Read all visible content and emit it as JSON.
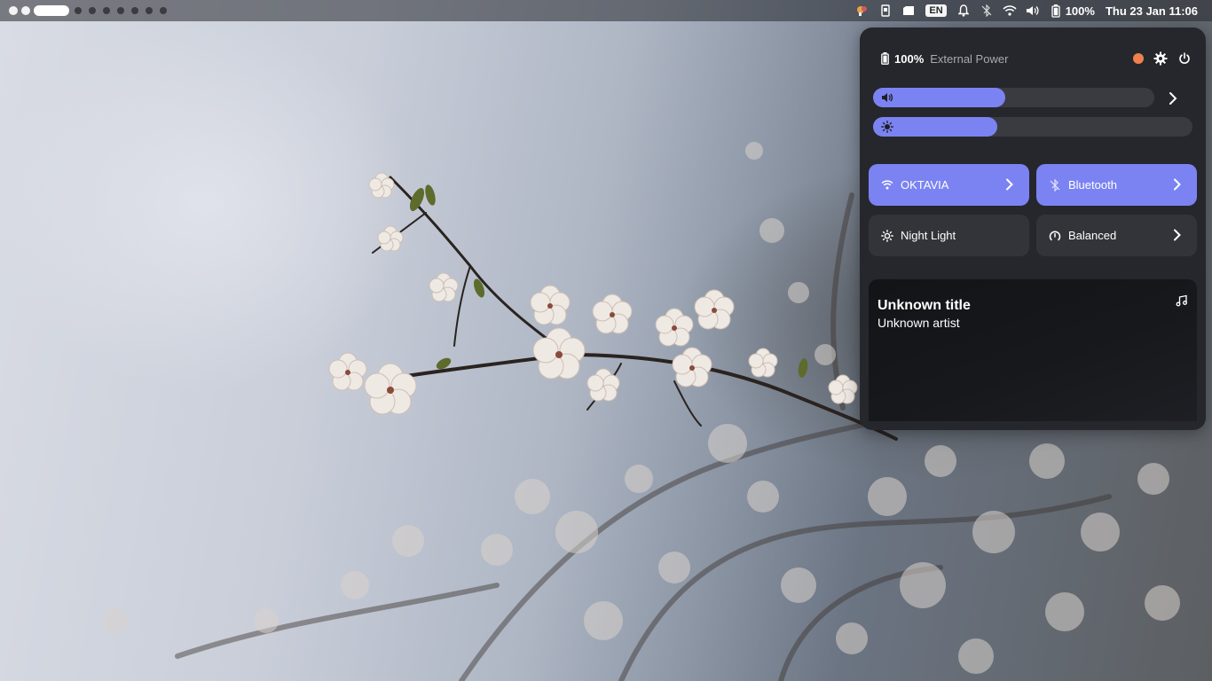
{
  "wallpaper": {
    "description_icon": "cherry-blossom-wallpaper"
  },
  "topbar": {
    "workspaces": {
      "count": 10,
      "active_index": 2
    },
    "tray_icons": [
      "app-indicator-icon",
      "sd-card-icon",
      "drive-icon"
    ],
    "keyboard_layout": "EN",
    "battery_percent": "100%",
    "clock": "Thu 23 Jan 11:06"
  },
  "quick_settings": {
    "battery_value": "100%",
    "power_source": "External Power",
    "volume_level": 0.47,
    "brightness_level": 0.39,
    "tiles": {
      "wifi": "OKTAVIA",
      "bluetooth": "Bluetooth",
      "night_light": "Night Light",
      "power_mode": "Balanced"
    },
    "media": {
      "title": "Unknown title",
      "artist": "Unknown artist"
    }
  },
  "colors": {
    "accent": "#7b83f2",
    "panel_bg": "#26272c",
    "tile_bg": "#333439",
    "record_indicator": "#f08050"
  }
}
